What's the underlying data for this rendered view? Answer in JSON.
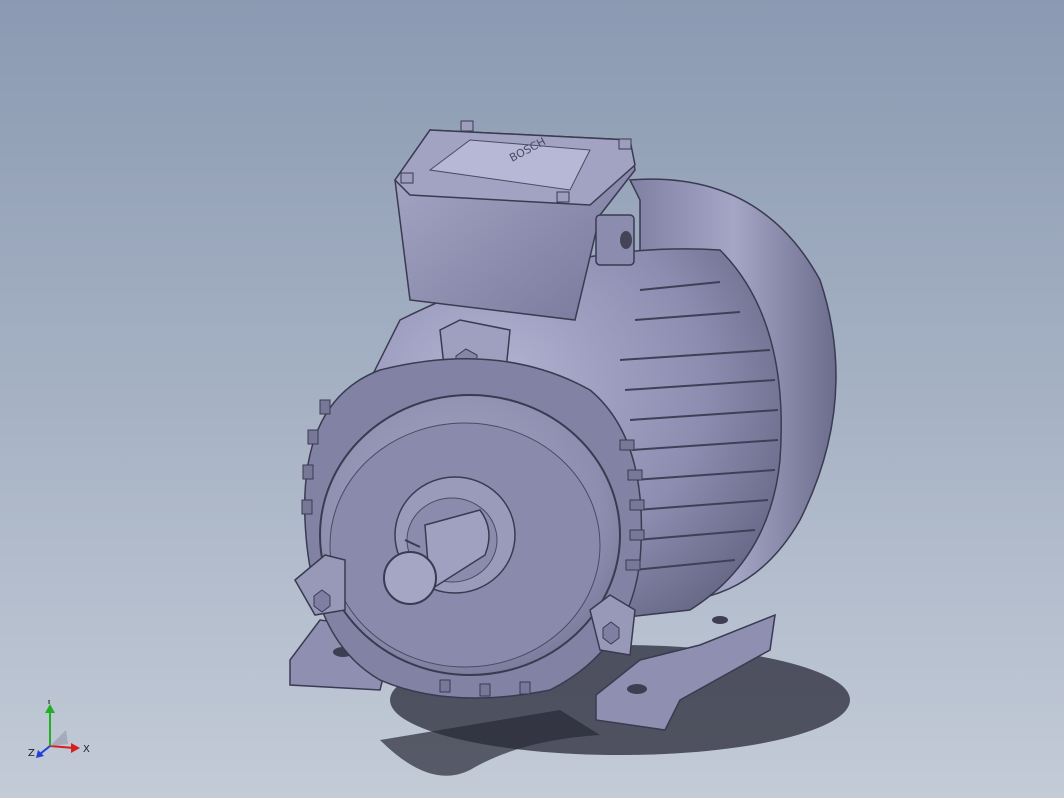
{
  "viewport": {
    "background_top": "#8b9ab2",
    "background_bottom": "#c3cbd7",
    "model_color": "#8e8fb0"
  },
  "model": {
    "name_icon": "electric-motor-3d-model",
    "terminal_box_text": "BOSCH"
  },
  "triad": {
    "x_label": "X",
    "y_label": "Y",
    "z_label": "Z",
    "x_color": "#d62020",
    "y_color": "#22b022",
    "z_color": "#2040d8"
  }
}
